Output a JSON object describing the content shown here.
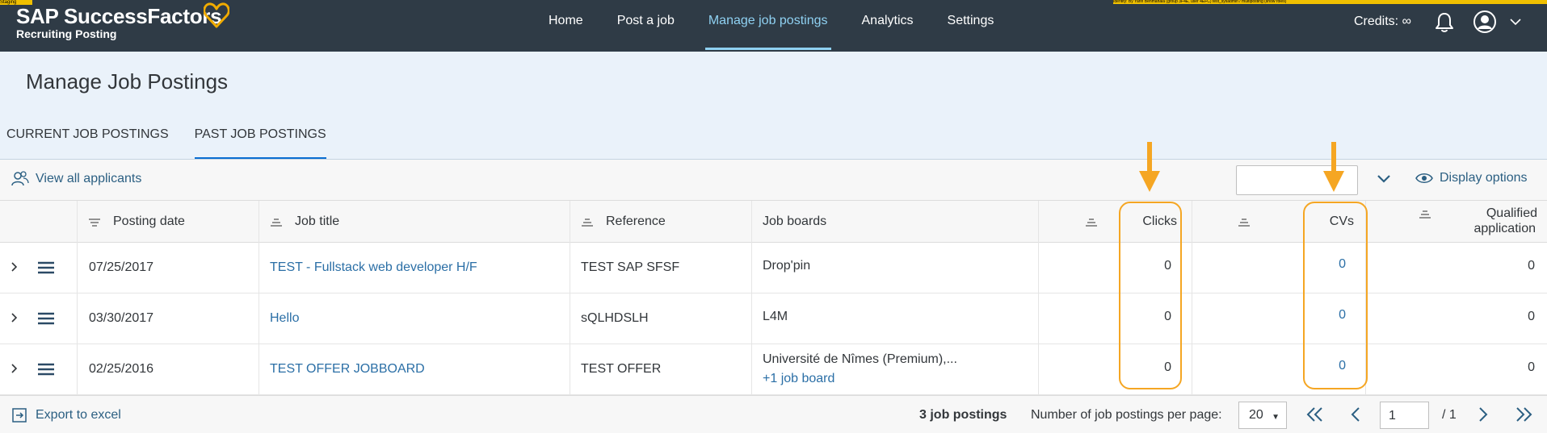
{
  "app": {
    "brand_name": "SAP SuccessFactors",
    "brand_sub": "Recruiting Posting",
    "corner_tag": "Staging",
    "debug_text": "Identity: By Yann Benmahala (group 3F4E, user 4EFC) test_sysadmin / multiposting (show roles)"
  },
  "nav": {
    "items": [
      {
        "label": "Home"
      },
      {
        "label": "Post a job"
      },
      {
        "label": "Manage job postings"
      },
      {
        "label": "Analytics"
      },
      {
        "label": "Settings"
      }
    ],
    "active_index": 2
  },
  "header": {
    "credits": "Credits: ∞",
    "title": "Manage Job Postings"
  },
  "tabs": [
    {
      "label": "CURRENT JOB POSTINGS"
    },
    {
      "label": "PAST JOB POSTINGS"
    }
  ],
  "toolbar": {
    "view_all": "View all applicants",
    "search_value": "",
    "display_options": "Display options"
  },
  "table": {
    "columns": [
      {
        "label": "Posting date"
      },
      {
        "label": "Job title"
      },
      {
        "label": "Reference"
      },
      {
        "label": "Job boards"
      },
      {
        "label": "Clicks"
      },
      {
        "label": "CVs"
      },
      {
        "label": "Qualified"
      },
      {
        "label": "application"
      }
    ],
    "rows": [
      {
        "date": "07/25/2017",
        "title": "TEST - Fullstack web developer H/F",
        "reference": "TEST SAP SFSF",
        "boards": "Drop'pin",
        "boards_extra": "",
        "clicks": "0",
        "cvs": "0",
        "qualified": "0"
      },
      {
        "date": "03/30/2017",
        "title": "Hello",
        "reference": "sQLHDSLH",
        "boards": "L4M",
        "boards_extra": "",
        "clicks": "0",
        "cvs": "0",
        "qualified": "0"
      },
      {
        "date": "02/25/2016",
        "title": "TEST OFFER JOBBOARD",
        "reference": "TEST OFFER",
        "boards": "Université de Nîmes (Premium),...",
        "boards_extra": "+1 job board",
        "clicks": "0",
        "cvs": "0",
        "qualified": "0"
      }
    ]
  },
  "footer": {
    "export": "Export to excel",
    "count": "3 job postings",
    "per_page_label": "Number of job postings per page:",
    "per_page_value": "20",
    "page_value": "1",
    "page_total": "/ 1"
  },
  "colors": {
    "topbar": "#2f3b46",
    "accent_nav": "#8fd1f2",
    "link": "#2b6fa6",
    "annotation": "#f5a623",
    "brand_heart": "#f0ab00"
  }
}
